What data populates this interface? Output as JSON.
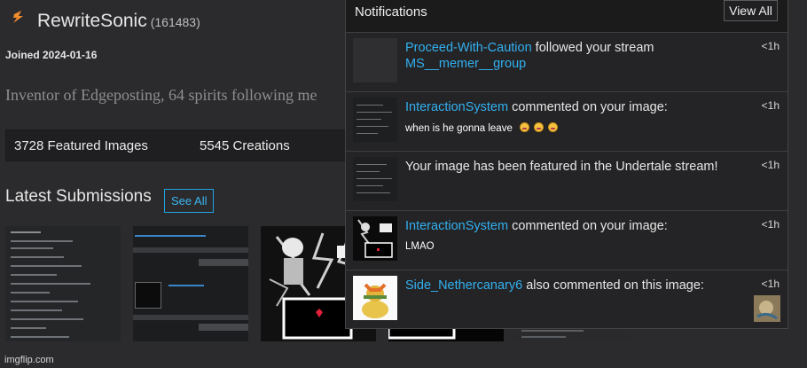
{
  "profile": {
    "username": "RewriteSonic",
    "points": "(161483)",
    "joined": "Joined 2024-01-16",
    "bio": "Inventor of Edgeposting, 64 spirits following me",
    "stats": [
      {
        "label": "3728 Featured Images"
      },
      {
        "label": "5545 Creations"
      }
    ],
    "latest_heading": "Latest Submissions",
    "see_all_label": "See All",
    "thumbnails": [
      "submission-thumb-1",
      "submission-thumb-2",
      "submission-thumb-3",
      "submission-thumb-4"
    ],
    "watermark": "imgflip.com"
  },
  "notifications": {
    "title": "Notifications",
    "view_all_label": "View All",
    "items": [
      {
        "user": "Proceed-With-Caution",
        "action": " followed your stream ",
        "target": "MS__memer__group",
        "comment": "",
        "time": "<1h"
      },
      {
        "user": "InteractionSystem",
        "action": " commented on your image:",
        "target": "",
        "comment": "when is he gonna leave",
        "time": "<1h"
      },
      {
        "user": "",
        "action": "Your image has been featured in the Undertale stream!",
        "target": "",
        "comment": "",
        "time": "<1h"
      },
      {
        "user": "InteractionSystem",
        "action": " commented on your image:",
        "target": "",
        "comment": "LMAO",
        "time": "<1h"
      },
      {
        "user": "Side_Nethercanary6",
        "action": " also commented on this image:",
        "target": "",
        "comment": "",
        "time": "<1h"
      }
    ]
  },
  "colors": {
    "accent": "#32b0f0",
    "background": "#2b2b2d",
    "panel": "#242426"
  },
  "icons": {
    "logo": "imgflip-lightning-icon",
    "emoji": "grinning-face-icon"
  }
}
